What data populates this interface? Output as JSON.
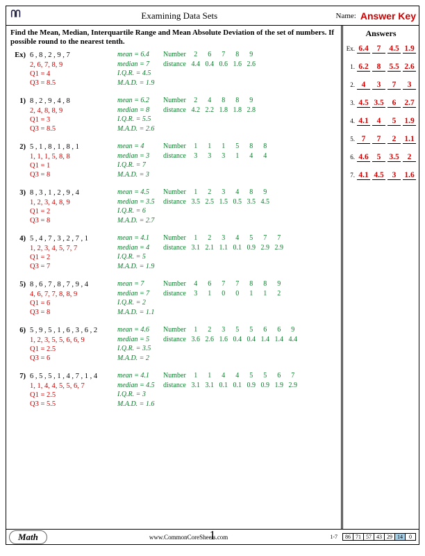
{
  "header": {
    "title": "Examining Data Sets",
    "name_label": "Name:",
    "answer_key": "Answer Key"
  },
  "instruction": "Find the Mean, Median, Interquartile Range and Mean Absolute Deviation of the set of numbers. If possible round to the nearest tenth.",
  "answers_title": "Answers",
  "problems": [
    {
      "num": "Ex)",
      "given": "6 , 8 , 2 , 9 , 7",
      "sorted": "2, 6, 7, 8, 9",
      "q1": "Q1 = 4",
      "q3": "Q3 = 8.5",
      "mean": "mean = 6.4",
      "median": "median = 7",
      "iqr": "I.Q.R. = 4.5",
      "mad": "M.A.D. = 1.9",
      "num_lbl": "Number",
      "dist_lbl": "distance",
      "nums": [
        "2",
        "6",
        "7",
        "8",
        "9"
      ],
      "dists": [
        "4.4",
        "0.4",
        "0.6",
        "1.6",
        "2.6"
      ]
    },
    {
      "num": "1)",
      "given": "8 , 2 , 9 , 4 , 8",
      "sorted": "2, 4, 8, 8, 9",
      "q1": "Q1 = 3",
      "q3": "Q3 = 8.5",
      "mean": "mean = 6.2",
      "median": "median = 8",
      "iqr": "I.Q.R. = 5.5",
      "mad": "M.A.D. = 2.6",
      "num_lbl": "Number",
      "dist_lbl": "distance",
      "nums": [
        "2",
        "4",
        "8",
        "8",
        "9"
      ],
      "dists": [
        "4.2",
        "2.2",
        "1.8",
        "1.8",
        "2.8"
      ]
    },
    {
      "num": "2)",
      "given": "5 , 1 , 8 , 1 , 8 , 1",
      "sorted": "1, 1, 1, 5, 8, 8",
      "q1": "Q1 = 1",
      "q3": "Q3 = 8",
      "mean": "mean = 4",
      "median": "median = 3",
      "iqr": "I.Q.R. = 7",
      "mad": "M.A.D. = 3",
      "num_lbl": "Number",
      "dist_lbl": "distance",
      "nums": [
        "1",
        "1",
        "1",
        "5",
        "8",
        "8"
      ],
      "dists": [
        "3",
        "3",
        "3",
        "1",
        "4",
        "4"
      ]
    },
    {
      "num": "3)",
      "given": "8 , 3 , 1 , 2 , 9 , 4",
      "sorted": "1, 2, 3, 4, 8, 9",
      "q1": "Q1 = 2",
      "q3": "Q3 = 8",
      "mean": "mean = 4.5",
      "median": "median = 3.5",
      "iqr": "I.Q.R. = 6",
      "mad": "M.A.D. = 2.7",
      "num_lbl": "Number",
      "dist_lbl": "distance",
      "nums": [
        "1",
        "2",
        "3",
        "4",
        "8",
        "9"
      ],
      "dists": [
        "3.5",
        "2.5",
        "1.5",
        "0.5",
        "3.5",
        "4.5"
      ]
    },
    {
      "num": "4)",
      "given": "5 , 4 , 7 , 3 , 2 , 7 , 1",
      "sorted": "1, 2, 3, 4, 5, 7, 7",
      "q1": "Q1 = 2",
      "q3": "Q3 = 7",
      "mean": "mean = 4.1",
      "median": "median = 4",
      "iqr": "I.Q.R. = 5",
      "mad": "M.A.D. = 1.9",
      "num_lbl": "Number",
      "dist_lbl": "distance",
      "nums": [
        "1",
        "2",
        "3",
        "4",
        "5",
        "7",
        "7"
      ],
      "dists": [
        "3.1",
        "2.1",
        "1.1",
        "0.1",
        "0.9",
        "2.9",
        "2.9"
      ]
    },
    {
      "num": "5)",
      "given": "8 , 6 , 7 , 8 , 7 , 9 , 4",
      "sorted": "4, 6, 7, 7, 8, 8, 9",
      "q1": "Q1 = 6",
      "q3": "Q3 = 8",
      "mean": "mean = 7",
      "median": "median = 7",
      "iqr": "I.Q.R. = 2",
      "mad": "M.A.D. = 1.1",
      "num_lbl": "Number",
      "dist_lbl": "distance",
      "nums": [
        "4",
        "6",
        "7",
        "7",
        "8",
        "8",
        "9"
      ],
      "dists": [
        "3",
        "1",
        "0",
        "0",
        "1",
        "1",
        "2"
      ]
    },
    {
      "num": "6)",
      "given": "5 , 9 , 5 , 1 , 6 , 3 , 6 , 2",
      "sorted": "1, 2, 3, 5, 5, 6, 6, 9",
      "q1": "Q1 = 2.5",
      "q3": "Q3 = 6",
      "mean": "mean = 4.6",
      "median": "median = 5",
      "iqr": "I.Q.R. = 3.5",
      "mad": "M.A.D. = 2",
      "num_lbl": "Number",
      "dist_lbl": "distance",
      "nums": [
        "1",
        "2",
        "3",
        "5",
        "5",
        "6",
        "6",
        "9"
      ],
      "dists": [
        "3.6",
        "2.6",
        "1.6",
        "0.4",
        "0.4",
        "1.4",
        "1.4",
        "4.4"
      ]
    },
    {
      "num": "7)",
      "given": "6 , 5 , 5 , 1 , 4 , 7 , 1 , 4",
      "sorted": "1, 1, 4, 4, 5, 5, 6, 7",
      "q1": "Q1 = 2.5",
      "q3": "Q3 = 5.5",
      "mean": "mean = 4.1",
      "median": "median = 4.5",
      "iqr": "I.Q.R. = 3",
      "mad": "M.A.D. = 1.6",
      "num_lbl": "Number",
      "dist_lbl": "distance",
      "nums": [
        "1",
        "1",
        "4",
        "4",
        "5",
        "5",
        "6",
        "7"
      ],
      "dists": [
        "3.1",
        "3.1",
        "0.1",
        "0.1",
        "0.9",
        "0.9",
        "1.9",
        "2.9"
      ]
    }
  ],
  "answers": [
    {
      "n": "Ex.",
      "v": [
        "6.4",
        "7",
        "4.5",
        "1.9"
      ]
    },
    {
      "n": "1.",
      "v": [
        "6.2",
        "8",
        "5.5",
        "2.6"
      ]
    },
    {
      "n": "2.",
      "v": [
        "4",
        "3",
        "7",
        "3"
      ]
    },
    {
      "n": "3.",
      "v": [
        "4.5",
        "3.5",
        "6",
        "2.7"
      ]
    },
    {
      "n": "4.",
      "v": [
        "4.1",
        "4",
        "5",
        "1.9"
      ]
    },
    {
      "n": "5.",
      "v": [
        "7",
        "7",
        "2",
        "1.1"
      ]
    },
    {
      "n": "6.",
      "v": [
        "4.6",
        "5",
        "3.5",
        "2"
      ]
    },
    {
      "n": "7.",
      "v": [
        "4.1",
        "4.5",
        "3",
        "1.6"
      ]
    }
  ],
  "footer": {
    "math": "Math",
    "url": "www.CommonCoreSheets.com",
    "page": "1",
    "range": "1-7",
    "scores": [
      "86",
      "71",
      "57",
      "43",
      "29",
      "14",
      "0"
    ],
    "hl_idx": 5
  }
}
